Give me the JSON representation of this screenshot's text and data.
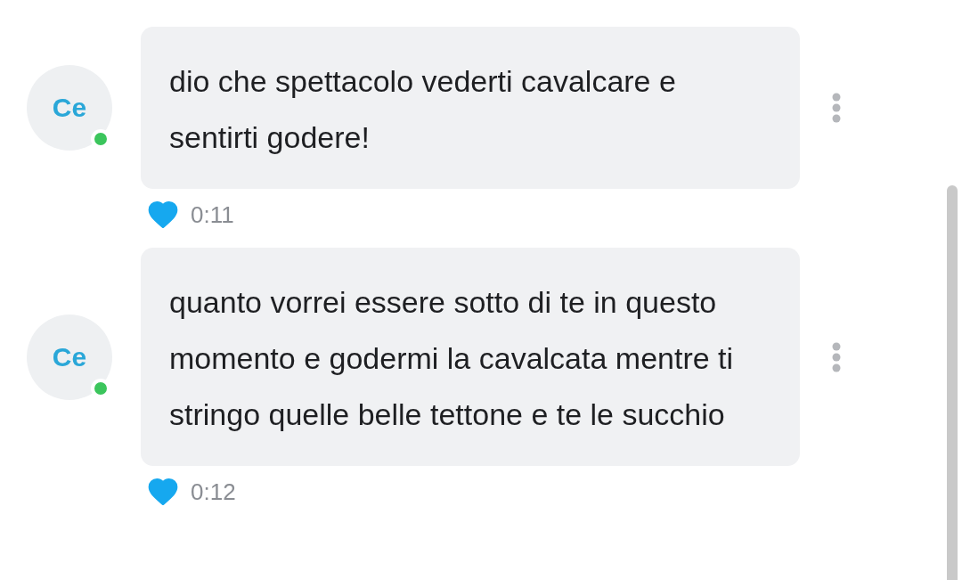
{
  "messages": [
    {
      "avatar": "Ce",
      "online": true,
      "text": "dio che spettacolo vederti cavalcare e sentirti godere!",
      "liked": true,
      "time": "0:11"
    },
    {
      "avatar": "Ce",
      "online": true,
      "text": "quanto vorrei essere sotto di te in questo momento e godermi la cavalcata mentre ti stringo quelle belle tettone e te le succhio",
      "liked": true,
      "time": "0:12"
    }
  ]
}
